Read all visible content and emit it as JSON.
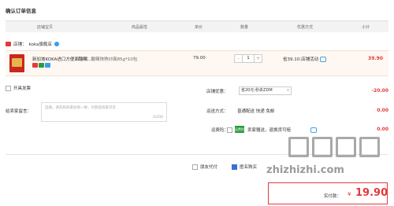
{
  "page_title": "确认订单信息",
  "header": {
    "store": "店铺宝贝",
    "attr": "商品属性",
    "price": "单价",
    "qty": "数量",
    "promo": "优惠方式",
    "subtotal": "小计"
  },
  "shop": {
    "label": "店铺：",
    "name": "koka旗舰店"
  },
  "item": {
    "name": "新加坡KOKA进口方便面酸辣…",
    "spec": "口味：酸辣快熟炒面85g*10包",
    "price": "79.00",
    "quantity": "1",
    "qty_minus": "-",
    "qty_plus": "+",
    "promo": "省39.10:店铺活动",
    "subtotal": "39.90"
  },
  "invoice": {
    "label": "开具发票"
  },
  "message": {
    "label": "给卖家留言：",
    "placeholder": "选填，请先和商家协商一致，付款后商家可见",
    "count": "0/200"
  },
  "coupon": {
    "label": "店铺优惠：",
    "selected": "省20元:秒杀ZDM",
    "amount": "-20.00"
  },
  "shipping": {
    "label": "运送方式：",
    "value": "普通配送 快递 免邮",
    "amount": "0.00"
  },
  "insurance": {
    "label": "运费险：",
    "tag": "运费险",
    "text": "卖家赠送，退换货可赔",
    "amount": "0.00"
  },
  "options": {
    "friend_pay": "朋友代付",
    "anonymous": "匿名购买"
  },
  "total": {
    "label": "实付款：",
    "currency": "¥",
    "value": "19.90"
  },
  "watermark": "zhizhizhi.com",
  "colors": {
    "accent": "#e4393c",
    "blue": "#3a6fd8",
    "badge_green": "#2a9a3a"
  }
}
